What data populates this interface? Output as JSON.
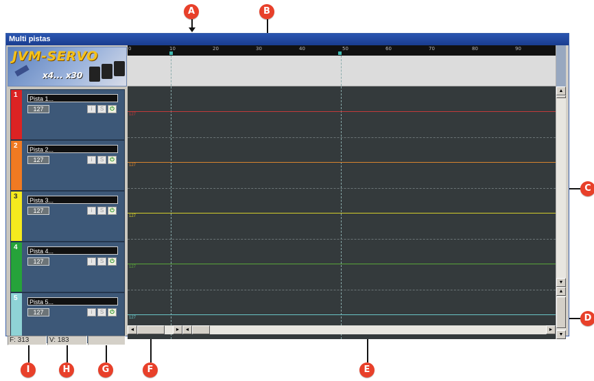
{
  "window": {
    "title": "Multi pistas"
  },
  "logo": {
    "text": "JVM-SERVO",
    "subtext": "x4... x30"
  },
  "tracks": [
    {
      "number": "1",
      "name": "Pista 1...",
      "value": "127",
      "color": "#dc2323",
      "line_label": "127",
      "line_color": "#c43a3a"
    },
    {
      "number": "2",
      "name": "Pista 2...",
      "value": "127",
      "color": "#f07a22",
      "line_label": "127",
      "line_color": "#d9852e"
    },
    {
      "number": "3",
      "name": "Pista 3...",
      "value": "127",
      "color": "#f5ea1e",
      "line_label": "127",
      "line_color": "#d6cf2a"
    },
    {
      "number": "4",
      "name": "Pista 4...",
      "value": "127",
      "color": "#26a33a",
      "line_label": "127",
      "line_color": "#5aa63a"
    },
    {
      "number": "5",
      "name": "Pista 5...",
      "value": "127",
      "color": "#8fd3d6",
      "line_label": "127",
      "line_color": "#69c6c8"
    }
  ],
  "track_buttons": {
    "info": "i",
    "solo": "S",
    "power": "⏻"
  },
  "ruler": {
    "labels": [
      "0",
      "10",
      "20",
      "30",
      "40",
      "50",
      "60",
      "70",
      "80",
      "90"
    ]
  },
  "status": {
    "frame": "F: 313",
    "value": "V: 183",
    "third": ""
  },
  "callouts": [
    "A",
    "B",
    "C",
    "D",
    "E",
    "F",
    "G",
    "H",
    "I"
  ],
  "icons": {
    "scroll_up": "▲",
    "scroll_down": "▼",
    "scroll_left": "◄",
    "scroll_right": "►"
  },
  "colors": {
    "title_bar": "#1f4aa0",
    "canvas": "#343a3c",
    "marker": "#e8402a"
  }
}
